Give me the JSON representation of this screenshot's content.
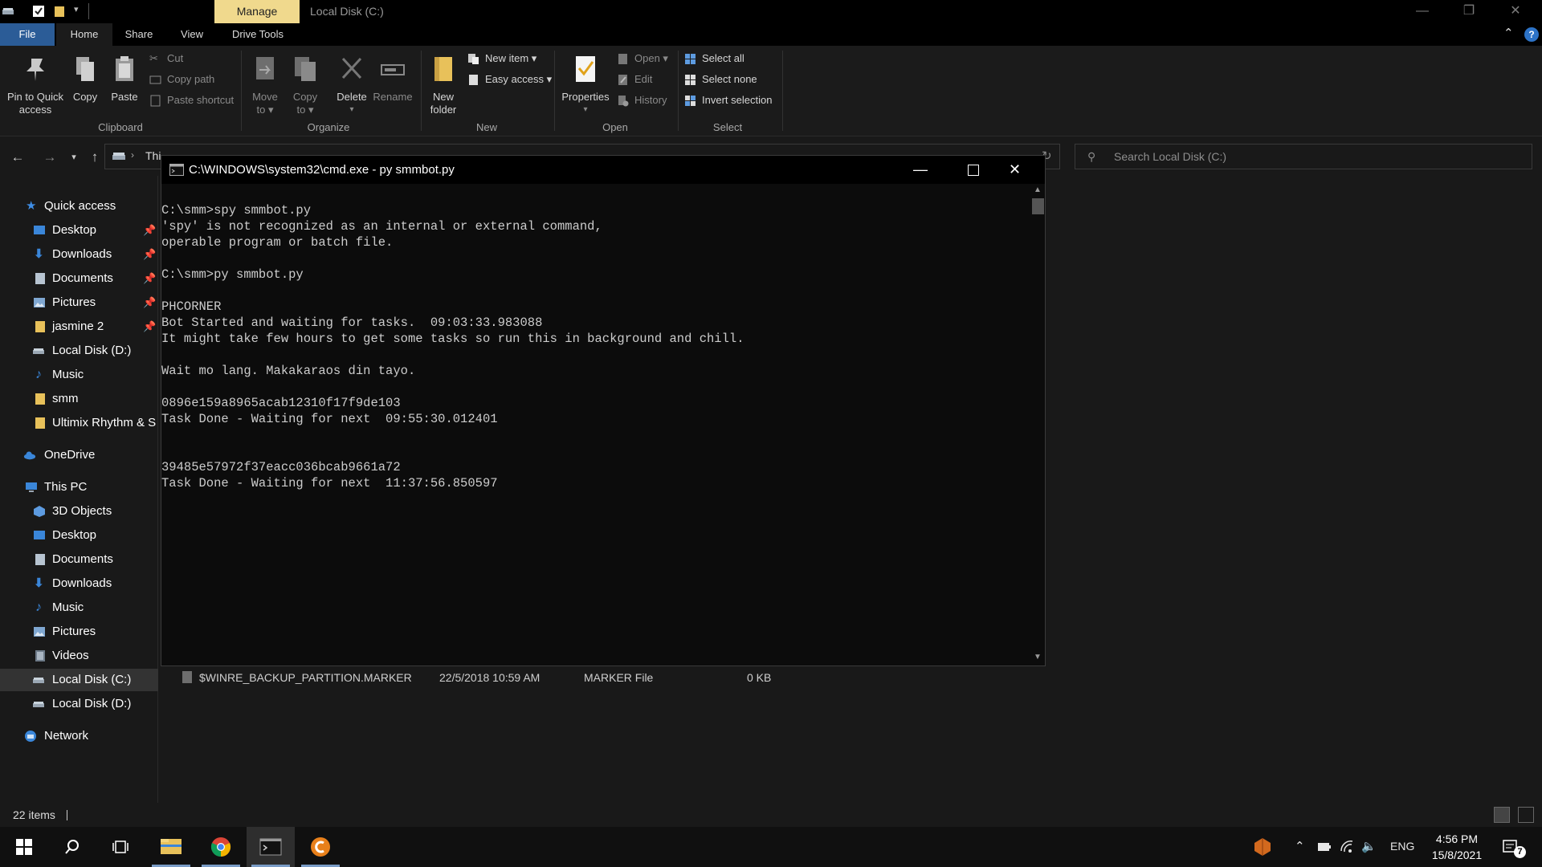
{
  "titlebar": {
    "manage_tab": "Manage",
    "window_title": "Local Disk (C:)",
    "minimize": "—",
    "maximize": "❐",
    "close": "✕"
  },
  "ribbon_tabs": [
    "File",
    "Home",
    "Share",
    "View",
    "Drive Tools"
  ],
  "ribbon": {
    "clipboard": {
      "pin_line1": "Pin to Quick",
      "pin_line2": "access",
      "copy": "Copy",
      "paste": "Paste",
      "cut": "Cut",
      "copy_path": "Copy path",
      "paste_shortcut": "Paste shortcut",
      "group": "Clipboard"
    },
    "organize": {
      "move_line1": "Move",
      "move_line2": "to ▾",
      "copy_line1": "Copy",
      "copy_line2": "to ▾",
      "delete": "Delete",
      "delete_arrow": "▾",
      "rename": "Rename",
      "group": "Organize"
    },
    "new": {
      "new_folder_line1": "New",
      "new_folder_line2": "folder",
      "new_item": "New item ▾",
      "easy_access": "Easy access ▾",
      "group": "New"
    },
    "open": {
      "properties": "Properties",
      "properties_arrow": "▾",
      "open": "Open ▾",
      "edit": "Edit",
      "history": "History",
      "group": "Open"
    },
    "select": {
      "select_all": "Select all",
      "select_none": "Select none",
      "invert": "Invert selection",
      "group": "Select"
    }
  },
  "address": {
    "path_visible": "Thi",
    "search_placeholder": "Search Local Disk (C:)"
  },
  "nav": {
    "quick_access": "Quick access",
    "quick_items": [
      "Desktop",
      "Downloads",
      "Documents",
      "Pictures",
      "jasmine 2",
      "Local Disk (D:)",
      "Music",
      "smm",
      "Ultimix Rhythm & S"
    ],
    "onedrive": "OneDrive",
    "this_pc": "This PC",
    "pc_items": [
      "3D Objects",
      "Desktop",
      "Documents",
      "Downloads",
      "Music",
      "Pictures",
      "Videos",
      "Local Disk (C:)",
      "Local Disk (D:)"
    ],
    "network": "Network"
  },
  "file_row": {
    "name": "$WINRE_BACKUP_PARTITION.MARKER",
    "date": "22/5/2018 10:59 AM",
    "type": "MARKER File",
    "size": "0 KB"
  },
  "status": {
    "items": "22 items"
  },
  "cmd": {
    "title": "C:\\WINDOWS\\system32\\cmd.exe - py  smmbot.py",
    "lines": [
      "C:\\smm>spy smmbot.py",
      "'spy' is not recognized as an internal or external command,",
      "operable program or batch file.",
      "",
      "C:\\smm>py smmbot.py",
      "",
      "PHCORNER",
      "Bot Started and waiting for tasks.  09:03:33.983088",
      "It might take few hours to get some tasks so run this in background and chill.",
      "",
      "Wait mo lang. Makakaraos din tayo.",
      "",
      "0896e159a8965acab12310f17f9de103",
      "Task Done - Waiting for next  09:55:30.012401",
      "",
      "",
      "39485e57972f37eacc036bcab9661a72",
      "Task Done - Waiting for next  11:37:56.850597"
    ]
  },
  "taskbar": {
    "lang": "ENG",
    "time": "4:56 PM",
    "date": "15/8/2021",
    "notif_count": "7"
  }
}
